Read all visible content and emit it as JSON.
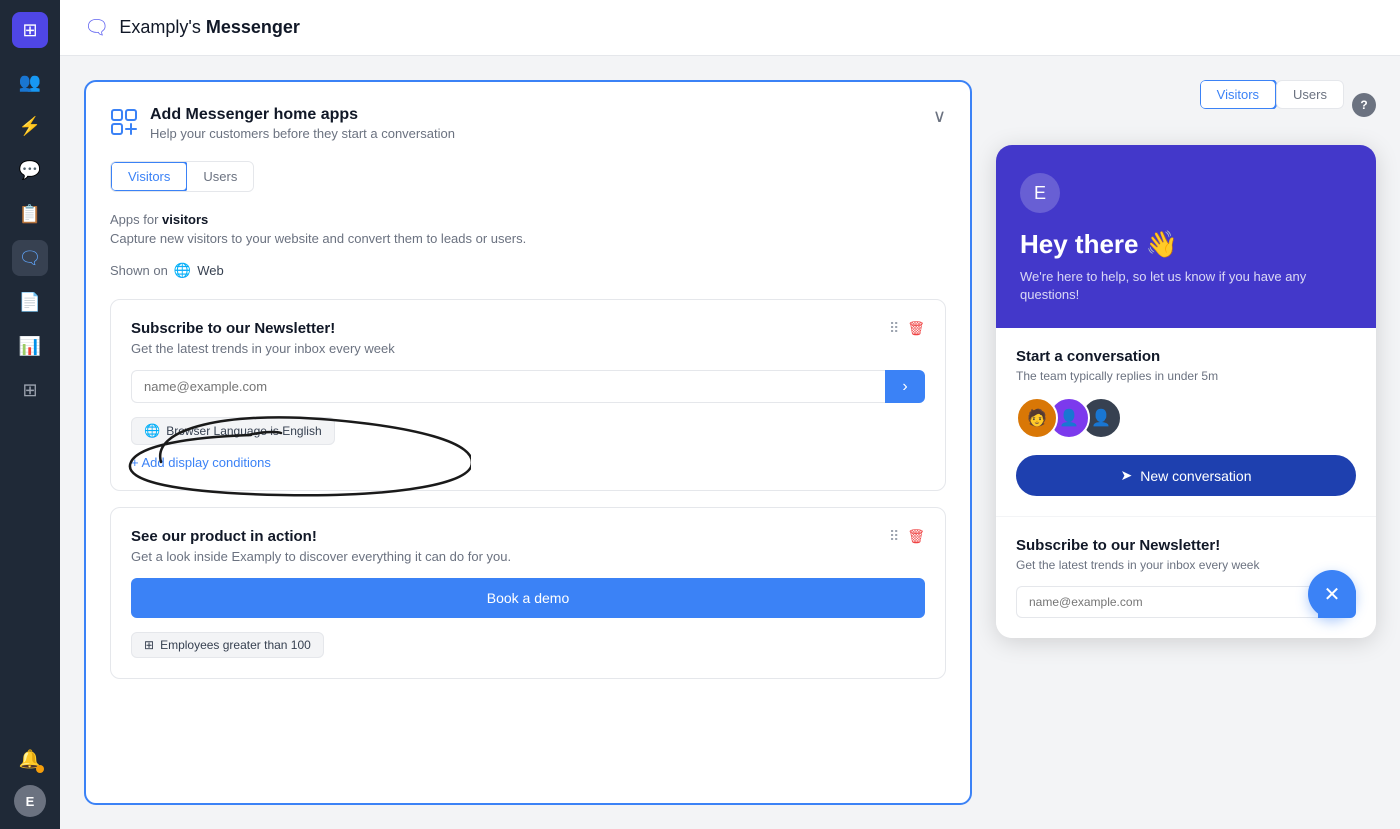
{
  "app": {
    "title_prefix": "Examply's",
    "title_suffix": "Messenger"
  },
  "sidebar": {
    "logo": "⊞",
    "items": [
      {
        "id": "users",
        "icon": "👥",
        "active": false
      },
      {
        "id": "campaigns",
        "icon": "⚡",
        "active": false
      },
      {
        "id": "chat",
        "icon": "💬",
        "active": false
      },
      {
        "id": "inbox",
        "icon": "📋",
        "active": false
      },
      {
        "id": "messenger",
        "icon": "🗨",
        "active": true
      },
      {
        "id": "reports",
        "icon": "📋",
        "active": false
      },
      {
        "id": "analytics",
        "icon": "📊",
        "active": false
      },
      {
        "id": "widgets",
        "icon": "⊞",
        "active": false
      }
    ],
    "notification_dot": true
  },
  "section": {
    "title": "Add Messenger home apps",
    "subtitle": "Help your customers before they start a conversation"
  },
  "tabs": {
    "visitors_label": "Visitors",
    "users_label": "Users"
  },
  "apps_section": {
    "label": "Apps for",
    "audience": "visitors",
    "description": "Capture new visitors to your website and convert them to leads or users.",
    "shown_on_label": "Shown on",
    "shown_on_platform": "Web"
  },
  "newsletter_card": {
    "title": "Subscribe to our Newsletter!",
    "description": "Get the latest trends in your inbox every week",
    "email_placeholder": "name@example.com",
    "submit_icon": "›",
    "condition_label": "Browser Language is English",
    "add_condition_label": "+ Add display conditions"
  },
  "product_card": {
    "title": "See our product in action!",
    "description": "Get a look inside Examply to discover everything it can do for you.",
    "button_label": "Book a demo",
    "condition_label": "Employees greater than 100"
  },
  "messenger_preview": {
    "logo_letter": "E",
    "greeting": "Hey there 👋",
    "subtext": "We're here to help, so let us know if you have any questions!",
    "start_conv_title": "Start a conversation",
    "start_conv_subtitle": "The team typically replies in under 5m",
    "new_conv_btn": "New conversation",
    "newsletter_title": "Subscribe to our Newsletter!",
    "newsletter_desc": "Get the latest trends in your inbox every week",
    "newsletter_placeholder": "name@example.com",
    "close_icon": "✕"
  },
  "colors": {
    "accent": "#3b82f6",
    "sidebar_bg": "#1f2937",
    "messenger_header": "#4338ca",
    "new_conv_bg": "#1e40af"
  }
}
